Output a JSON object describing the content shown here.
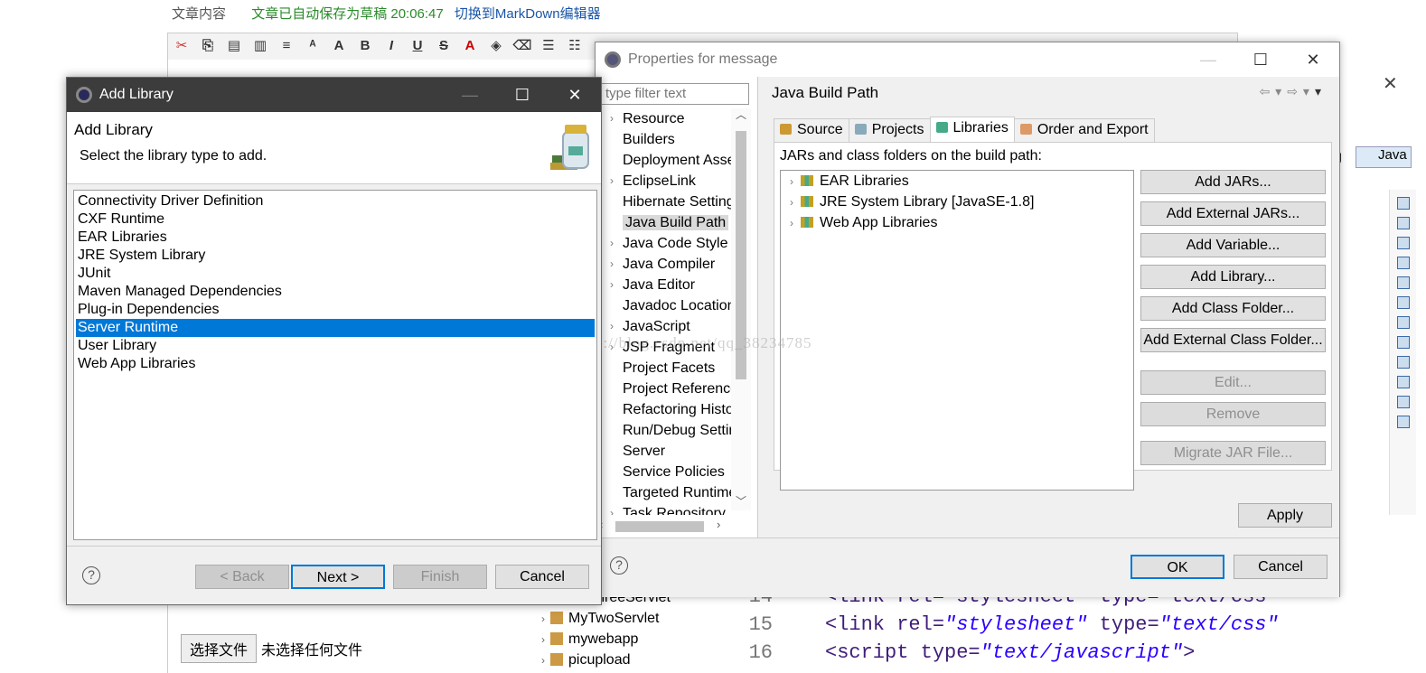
{
  "blog": {
    "content_label": "文章内容",
    "autosave": "文章已自动保存为草稿 20:06:47",
    "switch_editor": "切换到MarkDown编辑器",
    "file_button": "选择文件",
    "file_none": "未选择任何文件",
    "watermark": "http://blog.csdn.net/qq_38234785"
  },
  "background": {
    "tree": [
      "MyThreeServlet",
      "MyTwoServlet",
      "mywebapp",
      "picupload"
    ],
    "code": [
      {
        "ln": "14",
        "text": "<link rel=\"stylesheet\" type=\"text/css\""
      },
      {
        "ln": "15",
        "a": "<link rel=",
        "b": "\"stylesheet\"",
        "c": " type=",
        "d": "\"text/css\""
      },
      {
        "ln": "16",
        "a": "<script type=",
        "b": "\"text/javascript\"",
        "c": ">",
        "d": ""
      }
    ],
    "perspective": "Java",
    "perspective_prefix": "g"
  },
  "properties": {
    "title": "Properties for message",
    "filter_placeholder": "type filter text",
    "nav": [
      {
        "label": "Resource",
        "expandable": true
      },
      {
        "label": "Builders",
        "expandable": false
      },
      {
        "label": "Deployment Assembly",
        "expandable": false
      },
      {
        "label": "EclipseLink",
        "expandable": true
      },
      {
        "label": "Hibernate Settings",
        "expandable": false
      },
      {
        "label": "Java Build Path",
        "expandable": false,
        "selected": true
      },
      {
        "label": "Java Code Style",
        "expandable": true
      },
      {
        "label": "Java Compiler",
        "expandable": true
      },
      {
        "label": "Java Editor",
        "expandable": true
      },
      {
        "label": "Javadoc Location",
        "expandable": false
      },
      {
        "label": "JavaScript",
        "expandable": true
      },
      {
        "label": "JSP Fragment",
        "expandable": true
      },
      {
        "label": "Project Facets",
        "expandable": false
      },
      {
        "label": "Project References",
        "expandable": false
      },
      {
        "label": "Refactoring History",
        "expandable": false
      },
      {
        "label": "Run/Debug Settings",
        "expandable": false
      },
      {
        "label": "Server",
        "expandable": false
      },
      {
        "label": "Service Policies",
        "expandable": false
      },
      {
        "label": "Targeted Runtimes",
        "expandable": false
      },
      {
        "label": "Task Repository",
        "expandable": true
      }
    ],
    "page_title": "Java Build Path",
    "tabs": [
      "Source",
      "Projects",
      "Libraries",
      "Order and Export"
    ],
    "active_tab": "Libraries",
    "jars_label": "JARs and class folders on the build path:",
    "libraries": [
      "EAR Libraries",
      "JRE System Library [JavaSE-1.8]",
      "Web App Libraries"
    ],
    "buttons": {
      "add_jars": "Add JARs...",
      "add_external_jars": "Add External JARs...",
      "add_variable": "Add Variable...",
      "add_library": "Add Library...",
      "add_class_folder": "Add Class Folder...",
      "add_external_class_folder": "Add External Class Folder...",
      "edit": "Edit...",
      "remove": "Remove",
      "migrate": "Migrate JAR File...",
      "apply": "Apply",
      "ok": "OK",
      "cancel": "Cancel"
    }
  },
  "add_library": {
    "title": "Add Library",
    "heading": "Add Library",
    "description": "Select the library type to add.",
    "items": [
      "Connectivity Driver Definition",
      "CXF Runtime",
      "EAR Libraries",
      "JRE System Library",
      "JUnit",
      "Maven Managed Dependencies",
      "Plug-in Dependencies",
      "Server Runtime",
      "User Library",
      "Web App Libraries"
    ],
    "selected": "Server Runtime",
    "buttons": {
      "back": "< Back",
      "next": "Next >",
      "finish": "Finish",
      "cancel": "Cancel"
    },
    "help": "?"
  },
  "colors": {
    "selection": "#0078d7",
    "dialog_bg": "#f0f0f0",
    "title_dark": "#3c3c3c"
  }
}
